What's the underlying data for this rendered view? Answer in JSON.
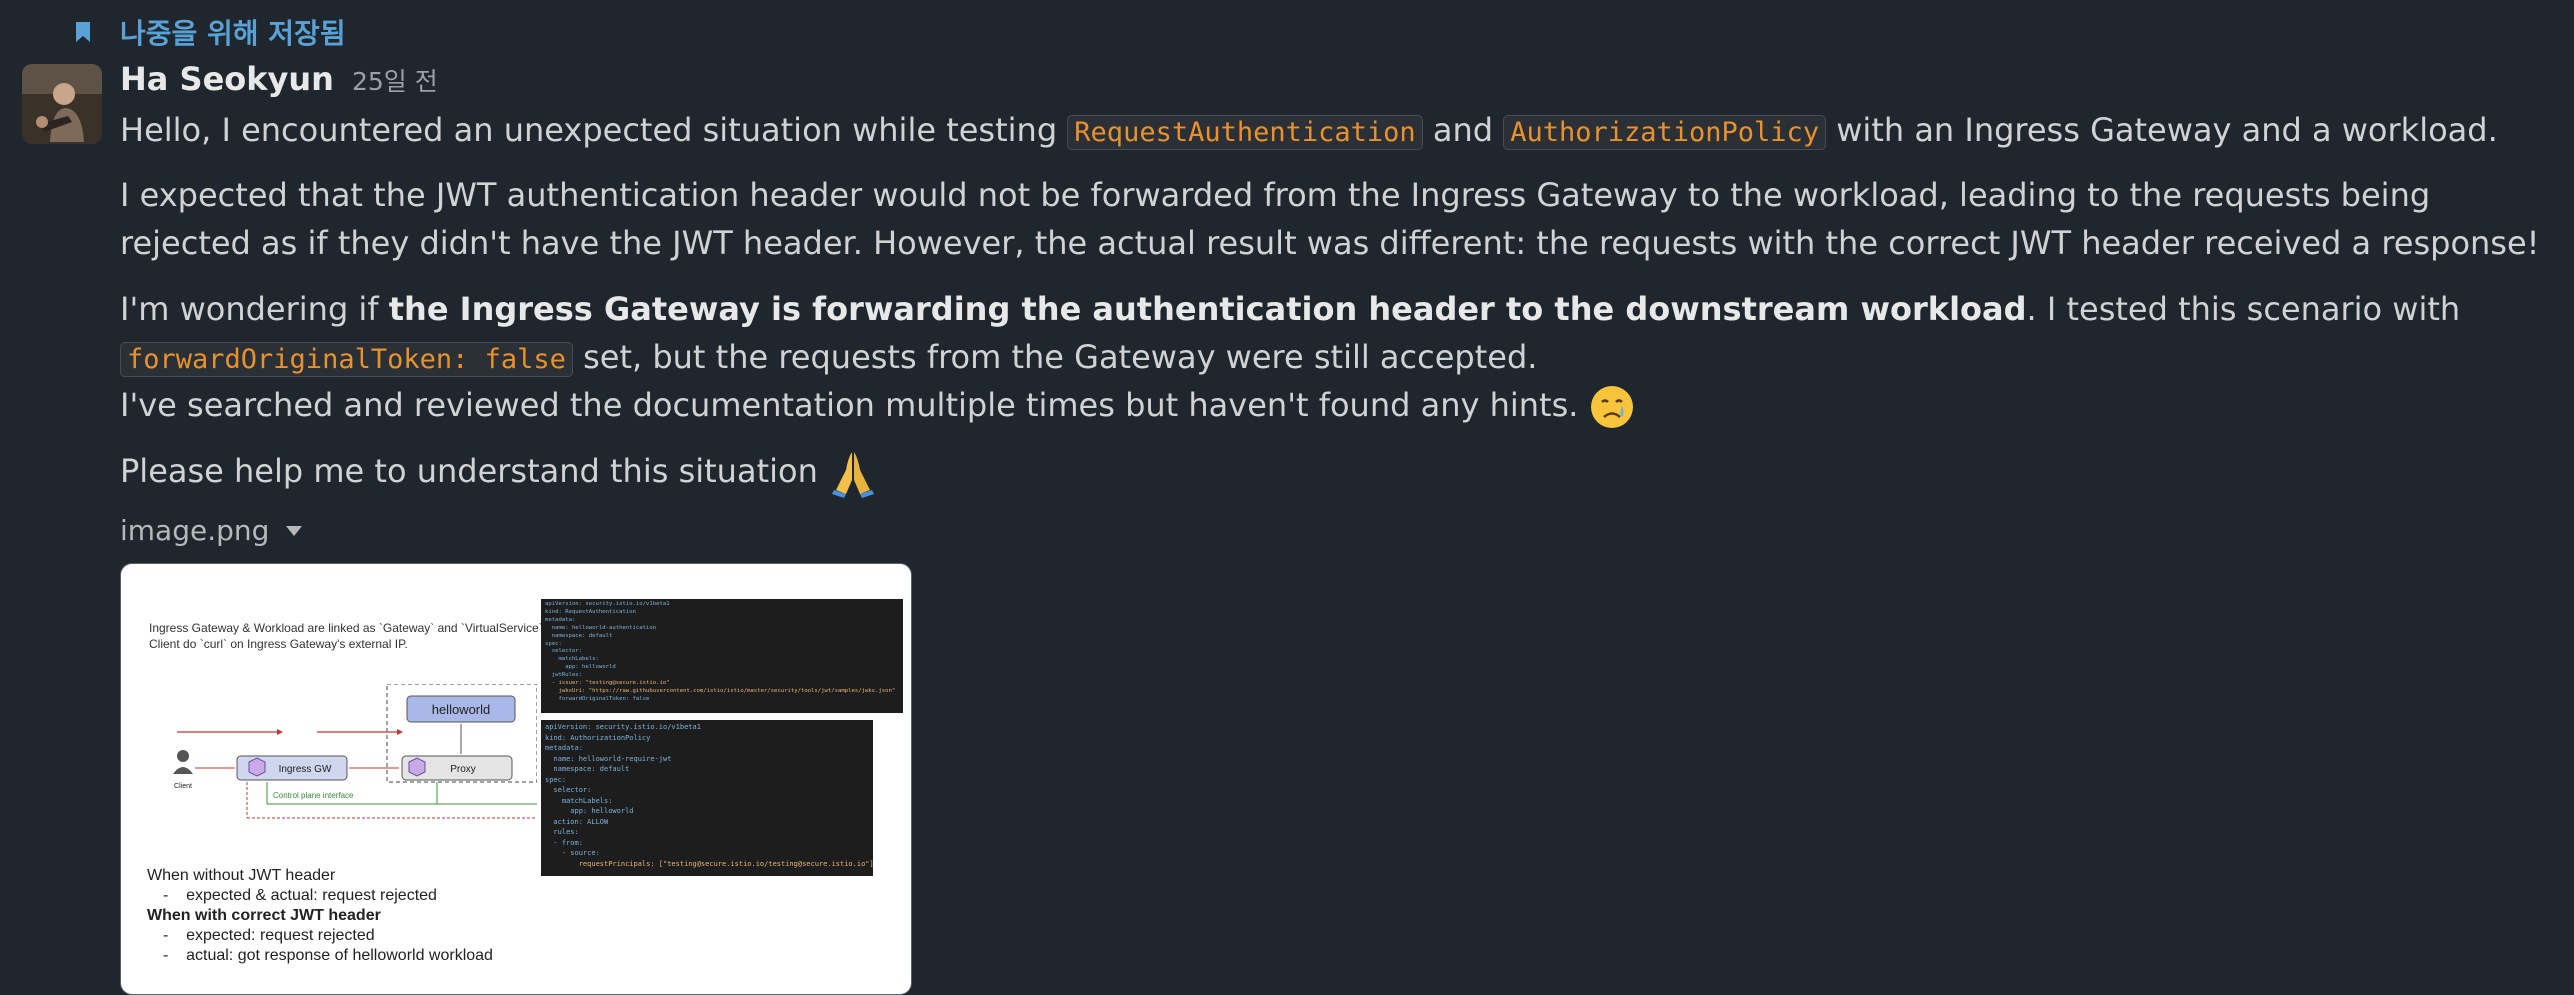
{
  "saved": {
    "label": "나중을 위해 저장됨",
    "icon": "bookmark-icon"
  },
  "message": {
    "author": "Ha Seokyun",
    "timestamp": "25일 전",
    "p1": {
      "pre": "Hello, I encountered an unexpected situation while testing ",
      "code1": "RequestAuthentication",
      "mid": " and ",
      "code2": "AuthorizationPolicy",
      "post": " with an Ingress Gateway and a workload."
    },
    "p2": "I expected that the JWT authentication header would not be forwarded from the Ingress Gateway to the workload, leading to the requests being rejected as if they didn't have the JWT header. However, the actual result was different: the requests with the correct JWT header received a response!",
    "p3": {
      "pre": "I'm wondering if ",
      "bold": "the Ingress Gateway is forwarding the authentication header to the downstream workload",
      "mid": ". I tested this scenario with ",
      "code": "forwardOriginalToken: false",
      "post": " set, but the requests from the Gateway were still accepted."
    },
    "p4": "I've searched and reviewed the documentation multiple times but haven't found any hints.",
    "p4_emoji": "crying-face-emoji",
    "p5": "Please help me to understand this situation",
    "p5_emoji": "folded-hands-emoji"
  },
  "attachment": {
    "filename": "image.png",
    "image": {
      "caption_line1": "Ingress Gateway & Workload are linked as `Gateway` and `VirtualService`.",
      "caption_line2": "Client do `curl` on Ingress Gateway's external IP.",
      "diagram": {
        "helloworld_label": "helloworld",
        "ingress_label": "Ingress GW",
        "proxy_label": "Proxy",
        "client_label": "Client",
        "control_plane_label": "Control plane interface"
      },
      "code1": [
        "apiVersion: security.istio.io/v1beta1",
        "kind: RequestAuthentication",
        "metadata:",
        "  name: helloworld-authentication",
        "  namespace: default",
        "spec:",
        "  selector:",
        "    matchLabels:",
        "      app: helloworld",
        "  jwtRules:",
        "  - issuer: \"testing@secure.istio.io\"",
        "    jwksUri: \"https://raw.githubusercontent.com/istio/istio/master/security/tools/jwt/samples/jwks.json\"",
        "    forwardOriginalToken: false"
      ],
      "code2": [
        "apiVersion: security.istio.io/v1beta1",
        "kind: AuthorizationPolicy",
        "metadata:",
        "  name: helloworld-require-jwt",
        "  namespace: default",
        "spec:",
        "  selector:",
        "    matchLabels:",
        "      app: helloworld",
        "  action: ALLOW",
        "  rules:",
        "  - from:",
        "    - source:",
        "        requestPrincipals: [\"testing@secure.istio.io/testing@secure.istio.io\"]"
      ],
      "notes": {
        "without_header": "When without JWT header",
        "without_bullet": "expected & actual: request rejected",
        "with_header": "When with correct JWT header",
        "with_bullet1": "expected: request rejected",
        "with_bullet2": "actual: got response of helloworld workload"
      }
    }
  },
  "colors": {
    "background": "#1f262e",
    "saved_accent": "#5aa2d6",
    "code_text": "#e8912d"
  }
}
